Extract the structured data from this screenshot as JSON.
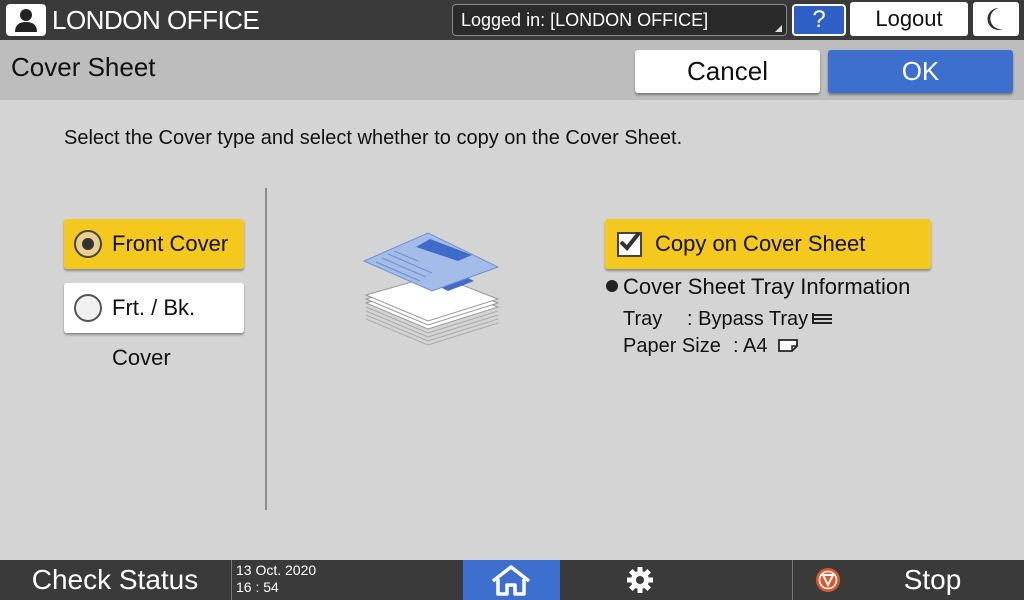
{
  "topbar": {
    "office_name": "LONDON OFFICE",
    "login_status": "Logged in: [LONDON OFFICE]",
    "help_label": "?",
    "logout_label": "Logout"
  },
  "header": {
    "title": "Cover Sheet",
    "cancel_label": "Cancel",
    "ok_label": "OK"
  },
  "main": {
    "instruction": "Select the Cover type and select whether to copy on the Cover Sheet.",
    "cover_options": [
      {
        "label": "Front Cover",
        "selected": true
      },
      {
        "label": "Frt. / Bk. Cover",
        "selected": false
      }
    ],
    "copy_on_cover": {
      "label": "Copy on Cover Sheet",
      "checked": true
    },
    "tray_info": {
      "title": "Cover Sheet Tray Information",
      "tray_label": "Tray",
      "tray_value": ": Bypass Tray",
      "paper_size_label": "Paper Size",
      "paper_size_value": ": A4"
    }
  },
  "bottombar": {
    "check_status": "Check Status",
    "date": "13 Oct. 2020",
    "time": "16 : 54",
    "stop_label": "Stop"
  },
  "colors": {
    "selected_yellow": "#f4c81c",
    "accent_blue": "#3d6fcf",
    "bar_dark": "#3a3a3a"
  }
}
